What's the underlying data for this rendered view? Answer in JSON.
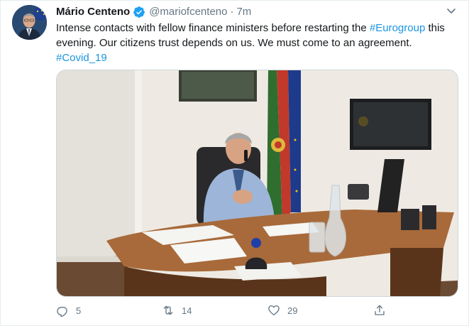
{
  "tweet": {
    "author": {
      "display_name": "Mário Centeno",
      "handle": "@mariofcenteno",
      "verified": true
    },
    "separator": "·",
    "timestamp": "7m",
    "text": {
      "part1": "Intense contacts with fellow finance ministers before restarting the ",
      "hashtag1": "#Eurogroup",
      "part2": " this evening. Our citizens trust depends on us. We must come to an agreement. ",
      "hashtag2": "#Covid_19"
    },
    "actions": {
      "reply_count": "5",
      "retweet_count": "14",
      "like_count": "29"
    },
    "colors": {
      "link": "#1b95e0",
      "secondary_text": "#657786",
      "primary_text": "#14171a",
      "verified_badge": "#1da1f2"
    },
    "icons": [
      "verified-badge-icon",
      "caret-down-icon",
      "reply-icon",
      "retweet-icon",
      "like-icon",
      "share-icon"
    ]
  }
}
